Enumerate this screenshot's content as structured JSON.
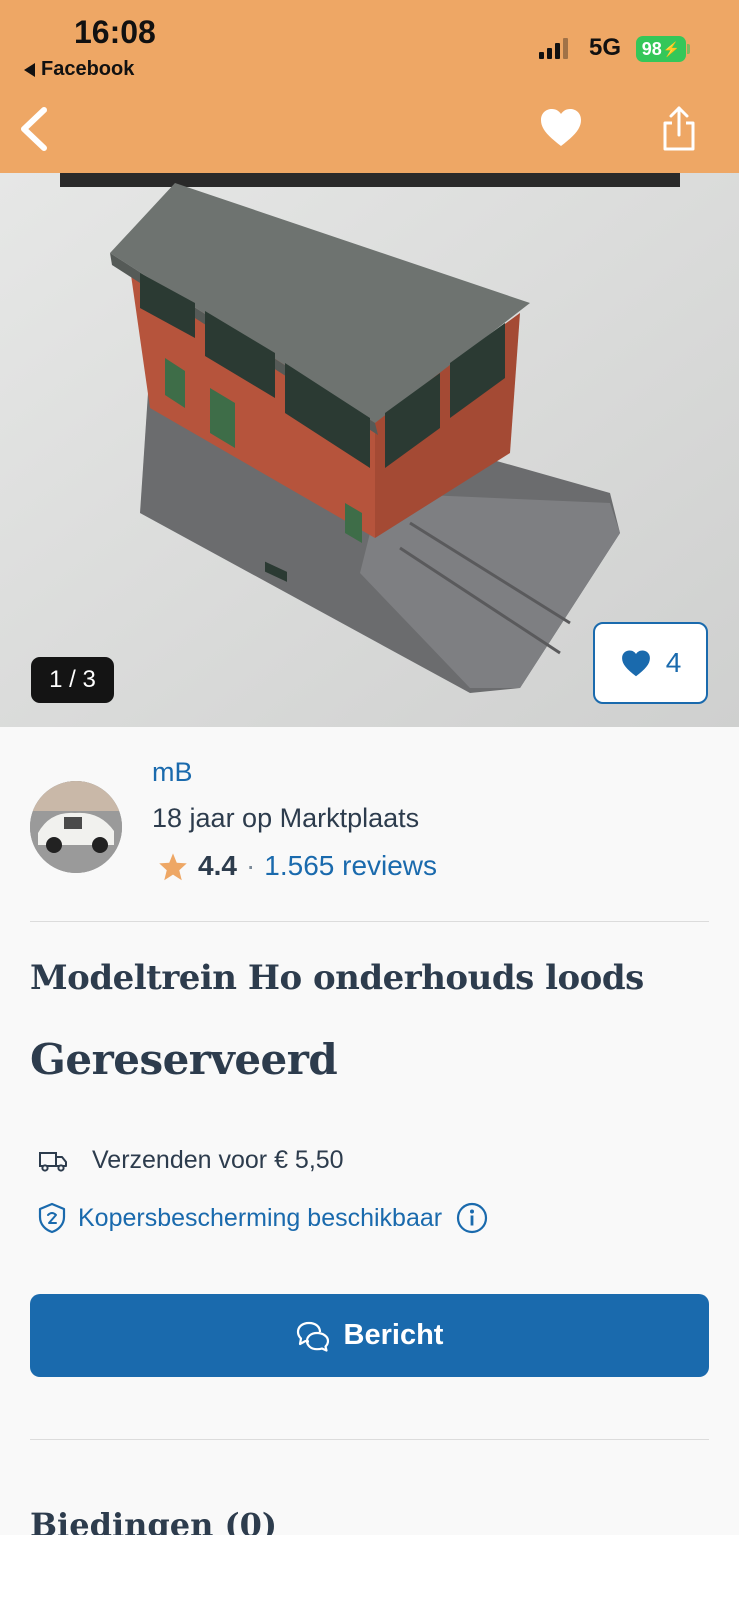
{
  "status_bar": {
    "time": "16:08",
    "back_app": "Facebook",
    "network": "5G",
    "battery": "98"
  },
  "nav": {
    "back_icon": "chevron-left-icon",
    "favorite_icon": "heart-icon",
    "share_icon": "share-icon"
  },
  "gallery": {
    "counter": "1 / 3",
    "favorites_count": "4"
  },
  "seller": {
    "name": "mB",
    "years": "18 jaar op Marktplaats",
    "rating": "4.4",
    "separator": "·",
    "reviews": "1.565 reviews"
  },
  "listing": {
    "title": "Modeltrein Ho onderhouds loods",
    "status": "Gereserveerd"
  },
  "shipping": {
    "label": "Verzenden voor € 5,50"
  },
  "protection": {
    "label": "Kopersbescherming beschikbaar"
  },
  "actions": {
    "message_label": "Bericht"
  },
  "bids": {
    "heading": "Biedingen (0)"
  },
  "colors": {
    "header": "#eea765",
    "primary": "#1a6aad",
    "text": "#2d3c4d",
    "star": "#eea765"
  }
}
